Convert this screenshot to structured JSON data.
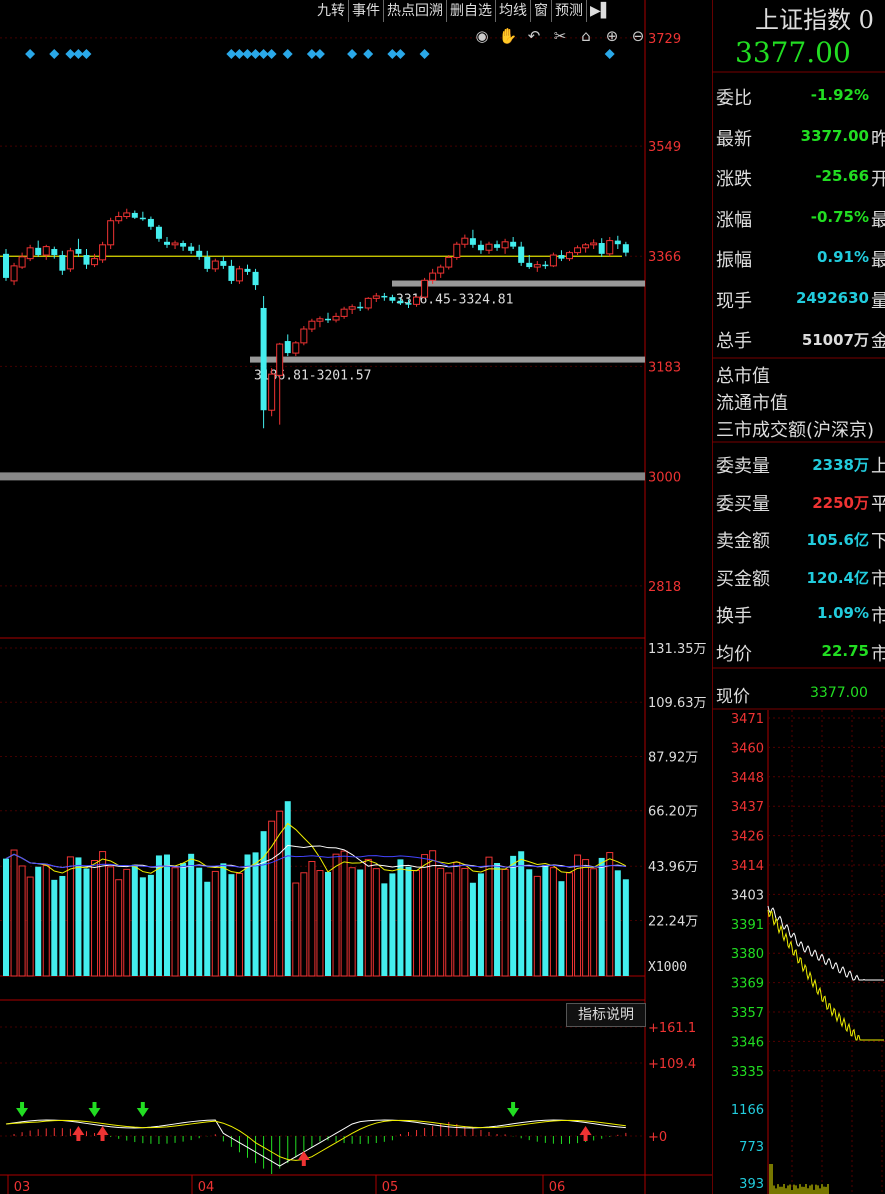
{
  "toolbar": {
    "items": [
      "九转",
      "事件",
      "热点回溯",
      "删自选",
      "均线",
      "窗",
      "预测"
    ],
    "arrow_label": "▶▌"
  },
  "chart_icons": [
    "eye-icon",
    "hand-icon",
    "undo-icon",
    "scissors-icon",
    "lock-icon",
    "zoom-in-icon",
    "zoom-out-icon"
  ],
  "chart_data": [
    {
      "type": "candlestick",
      "yticks": [
        "3729",
        "3549",
        "3366",
        "3183",
        "3000",
        "2818"
      ],
      "ylim": [
        2728,
        3792
      ],
      "baseline_price": 3366,
      "current_price": 3377.0,
      "annotations": [
        {
          "label": "3316.45-3324.81",
          "low": 3316.45,
          "high": 3324.81
        },
        {
          "label": "3186.81-3201.57",
          "low": 3186.81,
          "high": 3201.57
        }
      ],
      "ohlc": [
        [
          3370,
          3378,
          3325,
          3330
        ],
        [
          3325,
          3355,
          3318,
          3350
        ],
        [
          3348,
          3372,
          3345,
          3365
        ],
        [
          3362,
          3385,
          3358,
          3380
        ],
        [
          3380,
          3392,
          3365,
          3368
        ],
        [
          3368,
          3385,
          3360,
          3382
        ],
        [
          3378,
          3382,
          3362,
          3368
        ],
        [
          3368,
          3375,
          3335,
          3342
        ],
        [
          3345,
          3380,
          3340,
          3375
        ],
        [
          3378,
          3395,
          3365,
          3370
        ],
        [
          3368,
          3378,
          3345,
          3352
        ],
        [
          3352,
          3370,
          3348,
          3362
        ],
        [
          3360,
          3390,
          3355,
          3385
        ],
        [
          3385,
          3430,
          3378,
          3425
        ],
        [
          3425,
          3440,
          3420,
          3432
        ],
        [
          3432,
          3445,
          3428,
          3438
        ],
        [
          3438,
          3442,
          3428,
          3430
        ],
        [
          3430,
          3440,
          3425,
          3428
        ],
        [
          3428,
          3432,
          3410,
          3415
        ],
        [
          3415,
          3418,
          3390,
          3395
        ],
        [
          3390,
          3398,
          3380,
          3385
        ],
        [
          3385,
          3392,
          3378,
          3388
        ],
        [
          3388,
          3392,
          3375,
          3382
        ],
        [
          3382,
          3388,
          3370,
          3375
        ],
        [
          3375,
          3385,
          3360,
          3365
        ],
        [
          3365,
          3375,
          3340,
          3345
        ],
        [
          3345,
          3362,
          3340,
          3358
        ],
        [
          3358,
          3365,
          3345,
          3350
        ],
        [
          3350,
          3360,
          3320,
          3325
        ],
        [
          3325,
          3350,
          3320,
          3345
        ],
        [
          3345,
          3352,
          3335,
          3340
        ],
        [
          3340,
          3345,
          3310,
          3318
        ],
        [
          3280,
          3300,
          3080,
          3110
        ],
        [
          3110,
          3180,
          3100,
          3170
        ],
        [
          3168,
          3222,
          3086,
          3220
        ],
        [
          3225,
          3236,
          3200,
          3205
        ],
        [
          3205,
          3225,
          3200,
          3222
        ],
        [
          3222,
          3250,
          3218,
          3245
        ],
        [
          3245,
          3262,
          3240,
          3258
        ],
        [
          3258,
          3266,
          3248,
          3262
        ],
        [
          3262,
          3272,
          3255,
          3260
        ],
        [
          3260,
          3272,
          3256,
          3266
        ],
        [
          3266,
          3282,
          3262,
          3278
        ],
        [
          3278,
          3286,
          3270,
          3282
        ],
        [
          3282,
          3290,
          3275,
          3280
        ],
        [
          3280,
          3298,
          3276,
          3296
        ],
        [
          3296,
          3305,
          3290,
          3300
        ],
        [
          3300,
          3305,
          3292,
          3298
        ],
        [
          3298,
          3302,
          3288,
          3292
        ],
        [
          3292,
          3296,
          3285,
          3288
        ],
        [
          3288,
          3294,
          3280,
          3286
        ],
        [
          3286,
          3300,
          3282,
          3298
        ],
        [
          3298,
          3330,
          3296,
          3326
        ],
        [
          3326,
          3345,
          3320,
          3338
        ],
        [
          3338,
          3352,
          3330,
          3348
        ],
        [
          3348,
          3368,
          3344,
          3364
        ],
        [
          3364,
          3390,
          3360,
          3386
        ],
        [
          3386,
          3402,
          3380,
          3396
        ],
        [
          3396,
          3410,
          3380,
          3385
        ],
        [
          3385,
          3392,
          3370,
          3376
        ],
        [
          3376,
          3390,
          3370,
          3386
        ],
        [
          3386,
          3392,
          3375,
          3380
        ],
        [
          3380,
          3395,
          3370,
          3390
        ],
        [
          3390,
          3398,
          3378,
          3382
        ],
        [
          3382,
          3390,
          3350,
          3355
        ],
        [
          3355,
          3368,
          3345,
          3348
        ],
        [
          3348,
          3358,
          3340,
          3352
        ],
        [
          3352,
          3358,
          3345,
          3350
        ],
        [
          3350,
          3372,
          3348,
          3368
        ],
        [
          3368,
          3376,
          3358,
          3362
        ],
        [
          3362,
          3375,
          3358,
          3372
        ],
        [
          3372,
          3384,
          3368,
          3380
        ],
        [
          3380,
          3388,
          3372,
          3385
        ],
        [
          3385,
          3394,
          3378,
          3388
        ],
        [
          3388,
          3396,
          3365,
          3370
        ],
        [
          3370,
          3398,
          3366,
          3392
        ],
        [
          3392,
          3400,
          3378,
          3386
        ],
        [
          3386,
          3390,
          3366,
          3372
        ]
      ]
    },
    {
      "type": "bar",
      "yticks": [
        "131.35万",
        "109.63万",
        "87.92万",
        "66.20万",
        "43.96万",
        "22.24万"
      ],
      "unit": "X1000",
      "ylim": [
        0,
        131.35
      ]
    },
    {
      "type": "line",
      "yticks": [
        "+161.1",
        "+109.4",
        "+0"
      ]
    }
  ],
  "xaxis": [
    "03",
    "04",
    "05",
    "06"
  ],
  "indicator_button": "指标说明",
  "quote": {
    "title": "上证指数 0",
    "price": "3377.00",
    "rows": [
      {
        "label": "委比",
        "value": "-1.92%",
        "color": "#22dd22",
        "trail": ""
      },
      {
        "label": "最新",
        "value": "3377.00",
        "color": "#22dd22",
        "trail": "昨"
      },
      {
        "label": "涨跌",
        "value": "-25.66",
        "color": "#22dd22",
        "trail": "开"
      },
      {
        "label": "涨幅",
        "value": "-0.75%",
        "color": "#22dd22",
        "trail": "最"
      },
      {
        "label": "振幅",
        "value": "0.91%",
        "color": "#22ccdd",
        "trail": "最"
      },
      {
        "label": "现手",
        "value": "2492630",
        "color": "#22ccdd",
        "trail": "量"
      },
      {
        "label": "总手",
        "value": "51007万",
        "color": "#dddddd",
        "trail": "金"
      }
    ],
    "market_labels": [
      "总市值",
      "流通市值",
      "三市成交额(沪深京)"
    ],
    "rows2": [
      {
        "label": "委卖量",
        "value": "2338万",
        "color": "#22ccdd",
        "trail": "上"
      },
      {
        "label": "委买量",
        "value": "2250万",
        "color": "#ee3333",
        "trail": "平"
      },
      {
        "label": "卖金额",
        "value": "105.6亿",
        "color": "#22ccdd",
        "trail": "下"
      },
      {
        "label": "买金额",
        "value": "120.4亿",
        "color": "#22ccdd",
        "trail": "市"
      },
      {
        "label": "换手",
        "value": "1.09%",
        "color": "#22ccdd",
        "trail": "市"
      },
      {
        "label": "均价",
        "value": "22.75",
        "color": "#22dd22",
        "trail": "市"
      }
    ],
    "now_label": "现价",
    "now_value": "3377.00"
  },
  "mini_chart": {
    "price_ticks": [
      "3471",
      "3460",
      "3448",
      "3437",
      "3426",
      "3414",
      "3403",
      "3391",
      "3380",
      "3369",
      "3357",
      "3346",
      "3335"
    ],
    "vol_ticks": [
      "1166",
      "773",
      "393"
    ]
  }
}
